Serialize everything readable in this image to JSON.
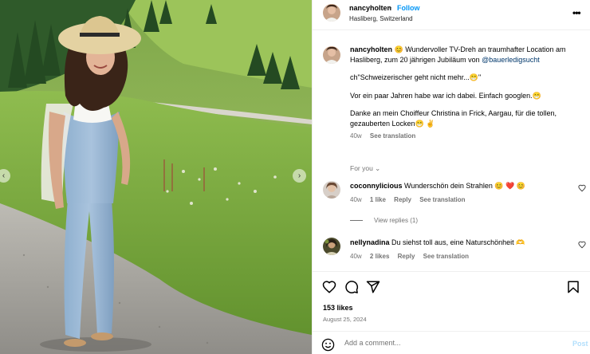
{
  "post": {
    "username": "nancyholten",
    "follow_label": "Follow",
    "dot": "•",
    "location": "Hasliberg, Switzerland",
    "more_label": "•••"
  },
  "caption": {
    "username": "nancyholten",
    "line1": "😊 Wundervoller TV-Dreh an traumhafter Location am Hasliberg, zum 20 jährigen Jubiläum von ",
    "mention": "@bauerledigsucht",
    "para2": "ch\"Schweizerischer geht nicht mehr...😁\"",
    "para3": "Vor ein paar Jahren habe war ich dabei. Einfach googlen.😁",
    "para4": "Danke an mein Choiffeur Christina in Frick, Aargau, für die tollen, gezauberten Locken😁 ✌",
    "time": "40w",
    "see_translation": "See translation"
  },
  "for_you": "For you ⌄",
  "comments": [
    {
      "username": "coconnylicious",
      "text": "Wunderschön dein Strahlen 😊 ❤️ 😊",
      "time": "40w",
      "likes": "1 like",
      "reply": "Reply",
      "see_translation": "See translation"
    },
    {
      "username": "nellynadina",
      "text": "Du siehst toll aus, eine Naturschönheit 🫶",
      "time": "40w",
      "likes": "2 likes",
      "reply": "Reply",
      "see_translation": "See translation"
    }
  ],
  "view_replies": "View replies (1)",
  "likes_count": "153 likes",
  "post_date": "August 25, 2024",
  "add_comment": {
    "placeholder": "Add a comment...",
    "post_label": "Post"
  },
  "icons": {
    "heart": "heart-icon",
    "comment": "comment-icon",
    "share": "share-icon",
    "save": "bookmark-icon",
    "emoji": "smiley-icon",
    "more": "more-horizontal-icon"
  },
  "colors": {
    "link": "#0095f6",
    "mention": "#00376b",
    "muted": "#737373",
    "post_disabled": "#b2dffc"
  }
}
